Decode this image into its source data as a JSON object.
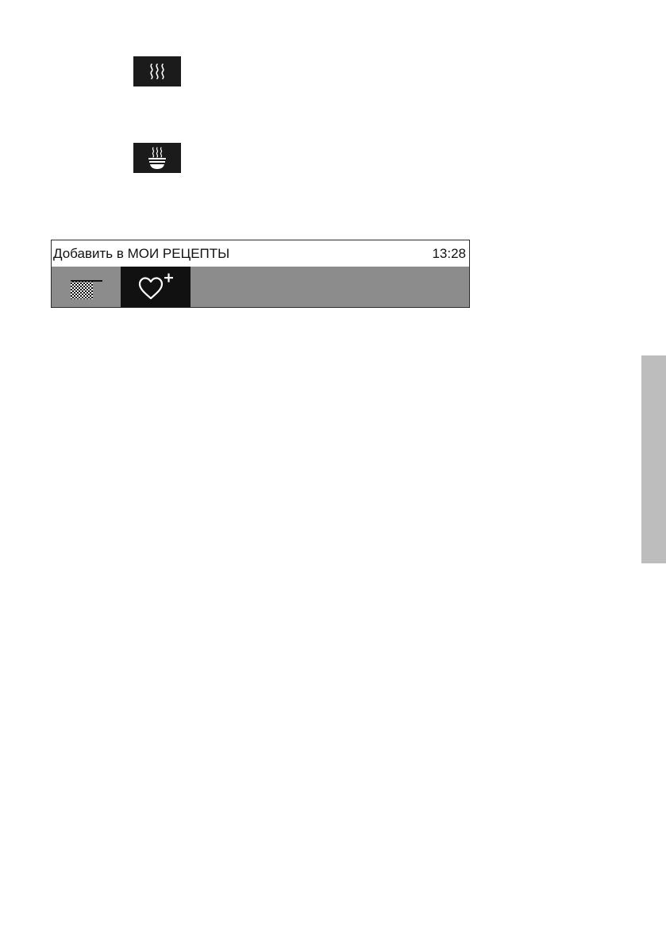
{
  "icons": {
    "steam": "steam-icon",
    "steam_bowl": "steam-bowl-icon",
    "grill": "grill-pattern-icon",
    "favorite_add": "heart-plus-icon"
  },
  "display": {
    "title": "Добавить в МОИ РЕЦЕПТЫ",
    "clock": "13:28",
    "selected_button": "favorite_add"
  },
  "colors": {
    "tile_bg": "#1b1b1b",
    "bar_bg": "#8c8c8c",
    "selected_bg": "#111111",
    "side_tab": "#bdbdbd"
  }
}
